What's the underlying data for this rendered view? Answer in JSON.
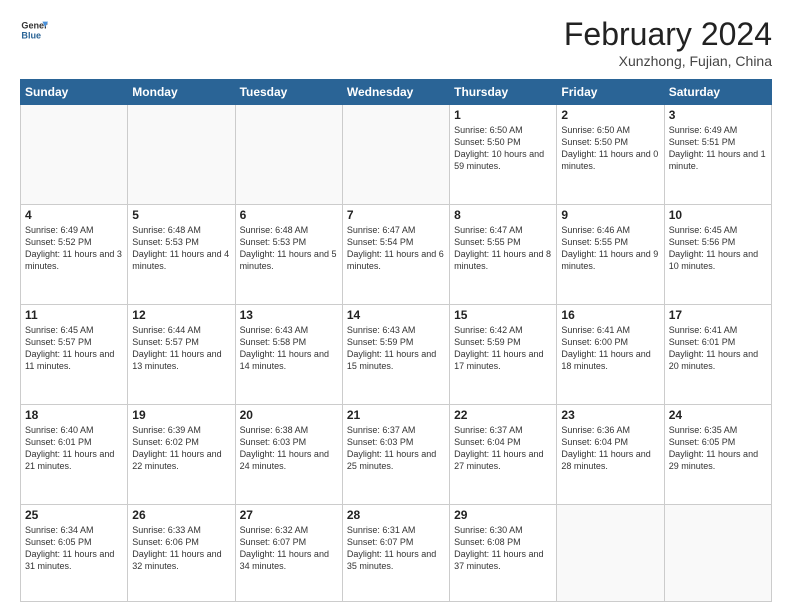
{
  "logo": {
    "general": "General",
    "blue": "Blue"
  },
  "header": {
    "month": "February 2024",
    "location": "Xunzhong, Fujian, China"
  },
  "days_of_week": [
    "Sunday",
    "Monday",
    "Tuesday",
    "Wednesday",
    "Thursday",
    "Friday",
    "Saturday"
  ],
  "weeks": [
    [
      {
        "day": "",
        "info": ""
      },
      {
        "day": "",
        "info": ""
      },
      {
        "day": "",
        "info": ""
      },
      {
        "day": "",
        "info": ""
      },
      {
        "day": "1",
        "info": "Sunrise: 6:50 AM\nSunset: 5:50 PM\nDaylight: 10 hours and 59 minutes."
      },
      {
        "day": "2",
        "info": "Sunrise: 6:50 AM\nSunset: 5:50 PM\nDaylight: 11 hours and 0 minutes."
      },
      {
        "day": "3",
        "info": "Sunrise: 6:49 AM\nSunset: 5:51 PM\nDaylight: 11 hours and 1 minute."
      }
    ],
    [
      {
        "day": "4",
        "info": "Sunrise: 6:49 AM\nSunset: 5:52 PM\nDaylight: 11 hours and 3 minutes."
      },
      {
        "day": "5",
        "info": "Sunrise: 6:48 AM\nSunset: 5:53 PM\nDaylight: 11 hours and 4 minutes."
      },
      {
        "day": "6",
        "info": "Sunrise: 6:48 AM\nSunset: 5:53 PM\nDaylight: 11 hours and 5 minutes."
      },
      {
        "day": "7",
        "info": "Sunrise: 6:47 AM\nSunset: 5:54 PM\nDaylight: 11 hours and 6 minutes."
      },
      {
        "day": "8",
        "info": "Sunrise: 6:47 AM\nSunset: 5:55 PM\nDaylight: 11 hours and 8 minutes."
      },
      {
        "day": "9",
        "info": "Sunrise: 6:46 AM\nSunset: 5:55 PM\nDaylight: 11 hours and 9 minutes."
      },
      {
        "day": "10",
        "info": "Sunrise: 6:45 AM\nSunset: 5:56 PM\nDaylight: 11 hours and 10 minutes."
      }
    ],
    [
      {
        "day": "11",
        "info": "Sunrise: 6:45 AM\nSunset: 5:57 PM\nDaylight: 11 hours and 11 minutes."
      },
      {
        "day": "12",
        "info": "Sunrise: 6:44 AM\nSunset: 5:57 PM\nDaylight: 11 hours and 13 minutes."
      },
      {
        "day": "13",
        "info": "Sunrise: 6:43 AM\nSunset: 5:58 PM\nDaylight: 11 hours and 14 minutes."
      },
      {
        "day": "14",
        "info": "Sunrise: 6:43 AM\nSunset: 5:59 PM\nDaylight: 11 hours and 15 minutes."
      },
      {
        "day": "15",
        "info": "Sunrise: 6:42 AM\nSunset: 5:59 PM\nDaylight: 11 hours and 17 minutes."
      },
      {
        "day": "16",
        "info": "Sunrise: 6:41 AM\nSunset: 6:00 PM\nDaylight: 11 hours and 18 minutes."
      },
      {
        "day": "17",
        "info": "Sunrise: 6:41 AM\nSunset: 6:01 PM\nDaylight: 11 hours and 20 minutes."
      }
    ],
    [
      {
        "day": "18",
        "info": "Sunrise: 6:40 AM\nSunset: 6:01 PM\nDaylight: 11 hours and 21 minutes."
      },
      {
        "day": "19",
        "info": "Sunrise: 6:39 AM\nSunset: 6:02 PM\nDaylight: 11 hours and 22 minutes."
      },
      {
        "day": "20",
        "info": "Sunrise: 6:38 AM\nSunset: 6:03 PM\nDaylight: 11 hours and 24 minutes."
      },
      {
        "day": "21",
        "info": "Sunrise: 6:37 AM\nSunset: 6:03 PM\nDaylight: 11 hours and 25 minutes."
      },
      {
        "day": "22",
        "info": "Sunrise: 6:37 AM\nSunset: 6:04 PM\nDaylight: 11 hours and 27 minutes."
      },
      {
        "day": "23",
        "info": "Sunrise: 6:36 AM\nSunset: 6:04 PM\nDaylight: 11 hours and 28 minutes."
      },
      {
        "day": "24",
        "info": "Sunrise: 6:35 AM\nSunset: 6:05 PM\nDaylight: 11 hours and 29 minutes."
      }
    ],
    [
      {
        "day": "25",
        "info": "Sunrise: 6:34 AM\nSunset: 6:05 PM\nDaylight: 11 hours and 31 minutes."
      },
      {
        "day": "26",
        "info": "Sunrise: 6:33 AM\nSunset: 6:06 PM\nDaylight: 11 hours and 32 minutes."
      },
      {
        "day": "27",
        "info": "Sunrise: 6:32 AM\nSunset: 6:07 PM\nDaylight: 11 hours and 34 minutes."
      },
      {
        "day": "28",
        "info": "Sunrise: 6:31 AM\nSunset: 6:07 PM\nDaylight: 11 hours and 35 minutes."
      },
      {
        "day": "29",
        "info": "Sunrise: 6:30 AM\nSunset: 6:08 PM\nDaylight: 11 hours and 37 minutes."
      },
      {
        "day": "",
        "info": ""
      },
      {
        "day": "",
        "info": ""
      }
    ]
  ]
}
